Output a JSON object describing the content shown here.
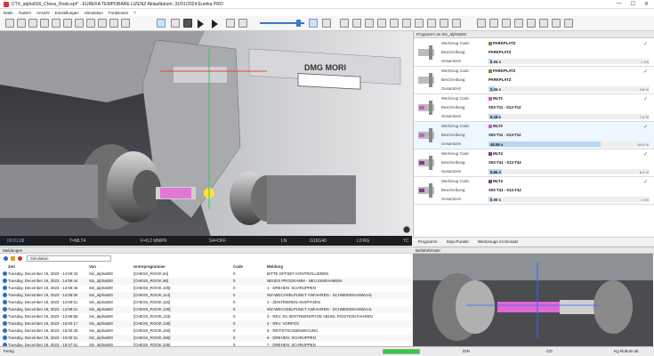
{
  "window": {
    "title": "CTX_alpha500_Chess_Rook.ept* - EUREKA TEMPORARE LIZENZ Ablaufdatum: 31/01/2024 Eureka PRO",
    "controls": [
      "—",
      "☐",
      "✕"
    ]
  },
  "menu": [
    "Datei",
    "Ändern",
    "Ansicht",
    "Einstellungen",
    "Simulation",
    "Funktionen",
    "?"
  ],
  "viewport": {
    "brand": "DMG MORI",
    "status": {
      "time": "00:01:08",
      "tool": "T=MLT4",
      "feed": "F=0.2 MMPR",
      "spindle": "S4=OFF",
      "mode": "LN",
      "gcode": "G18G40",
      "l0": "L0:RG",
      "tc": "TC"
    }
  },
  "tool_panel": {
    "header": "Programm an Sin_alpha500",
    "labels": {
      "code": "Werkzeug Code:",
      "desc": "Beschreibung:",
      "total": "Gesamtzeit"
    },
    "tools": [
      {
        "code": "PARKPLATZ",
        "desc": "PARKPLATZ",
        "time": "0.04 s",
        "pct": "< 1%",
        "color": "#7a8c3a",
        "fill": 0.01
      },
      {
        "code": "PARKPLATZ",
        "desc": "PARKPLATZ",
        "time": "2.34 s",
        "pct": "3.8 %",
        "color": "#7a8c3a",
        "fill": 0.038
      },
      {
        "code": "MLT2",
        "desc": "S03-T11 - S13-T12",
        "time": "5.16 s",
        "pct": "7.4 %",
        "color": "#c85ec8",
        "fill": 0.074
      },
      {
        "code": "MLT2",
        "desc": "S03-T11 - S13-T12",
        "time": "48.55 s",
        "pct": "69.5 %",
        "color": "#c85ec8",
        "fill": 0.695
      },
      {
        "code": "MLT4",
        "desc": "S03-T41 - S13-T42",
        "time": "5.84 s",
        "pct": "8.4 %",
        "color": "#8a3a8a",
        "fill": 0.084
      },
      {
        "code": "MLT4",
        "desc": "S03-T41 - S13-T42",
        "time": "0.00 s",
        "pct": "< 1%",
        "color": "#8a3a8a",
        "fill": 0.0
      }
    ]
  },
  "right_tabs": [
    "Programm",
    "Stop-Punkte",
    "Werkzeuge im Einsatz"
  ],
  "messages": {
    "header": "Meldungen",
    "filter": "Simulation",
    "columns": [
      "Zeit",
      "Von",
      "Unterprogramme",
      "Code",
      "Meldung"
    ],
    "rows": [
      [
        "Tuesday, December 19, 2023 - 14:59:43",
        "Sin_alpha500",
        "[CHESS_ROOK,84]",
        "0",
        "BITTE OFFSET KONTROLLIEREN"
      ],
      [
        "Tuesday, December 19, 2023 - 14:59:44",
        "Sin_alpha500",
        "[CHESS_ROOK,98]",
        "0",
        "NEUES PROGRAMM - NEU EINRAHMEN!"
      ],
      [
        "Tuesday, December 19, 2023 - 14:59:45",
        "Sin_alpha500",
        "[CHESS_ROOK,105]",
        "0",
        "1 - DREHEN: SCHRUPPEN"
      ],
      [
        "Tuesday, December 19, 2023 - 14:59:50",
        "Sin_alpha500",
        "[CHESS_ROOK,114]",
        "0",
        "WZ-WECHSELPUNKT ANFAHREN - SCHNEIDENANWAHL"
      ],
      [
        "Tuesday, December 19, 2023 - 14:59:51",
        "Sin_alpha500",
        "[CHESS_ROOK,116]",
        "0",
        "2 - ZENTRIEREN ANSPITZEN"
      ],
      [
        "Tuesday, December 19, 2023 - 14:59:51",
        "Sin_alpha500",
        "[CHESS_ROOK,126]",
        "0",
        "WZ-WECHSELPUNKT ANFAHREN - SCHNEIDENANWAHL"
      ],
      [
        "Tuesday, December 19, 2023 - 14:59:56",
        "Sin_alpha500",
        "[CHESS_ROOK,133]",
        "0",
        "3 - REV. ZU ZENTRIERSPITZE ABHOL POSITION FAHREN"
      ],
      [
        "Tuesday, December 19, 2023 - 15:00:17",
        "Sin_alpha500",
        "[CHESS_ROOK,138]",
        "0",
        "4 - REV. VORPOS"
      ],
      [
        "Tuesday, December 19, 2023 - 15:00:25",
        "Sin_alpha500",
        "[CHESS_ROOK,160]",
        "0",
        "5 - REITSTOCKBEWEGUNG"
      ],
      [
        "Tuesday, December 19, 2023 - 15:00:31",
        "Sin_alpha500",
        "[CHESS_ROOK,186]",
        "0",
        "6 - DREHEN: SCHRUPPEN"
      ],
      [
        "Tuesday, December 19, 2023 - 15:07:51",
        "Sin_alpha500",
        "[CHESS_ROOK,236]",
        "0",
        "7 - DREHEN: SCHRUPPEN"
      ]
    ]
  },
  "miniview": {
    "header": "Beifahrfenster"
  },
  "statusbar": {
    "left": "Fertig",
    "progress": 1.0,
    "mid": "DIN",
    "mid2": "CD",
    "right": "Kg Robots ait"
  }
}
